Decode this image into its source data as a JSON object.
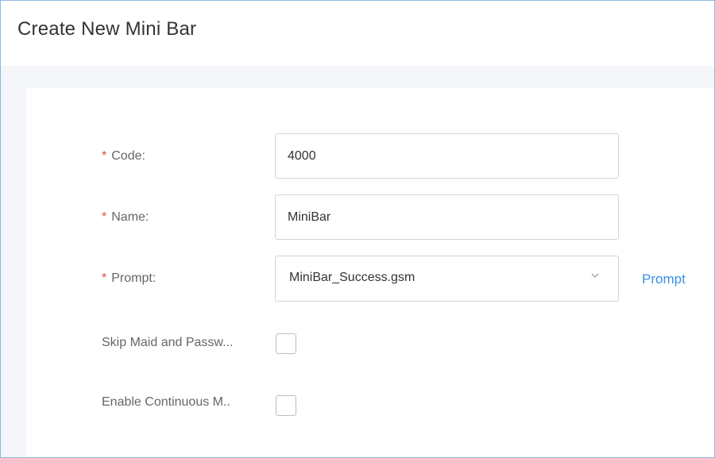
{
  "header": {
    "title": "Create New Mini Bar"
  },
  "form": {
    "code": {
      "label": "Code:",
      "required_mark": "*",
      "value": "4000"
    },
    "name": {
      "label": "Name:",
      "required_mark": "*",
      "value": "MiniBar"
    },
    "prompt": {
      "label": "Prompt:",
      "required_mark": "*",
      "selected": "MiniBar_Success.gsm",
      "link_label": "Prompt"
    },
    "skip_maid": {
      "label": "Skip Maid and Passw...",
      "checked": false
    },
    "continuous": {
      "label": "Enable Continuous M..",
      "checked": false
    }
  },
  "colors": {
    "required": "#e8474d",
    "link": "#3a8ee6",
    "border": "#8fb9dd"
  },
  "icons": {
    "dropdown": "chevron-down-icon"
  }
}
